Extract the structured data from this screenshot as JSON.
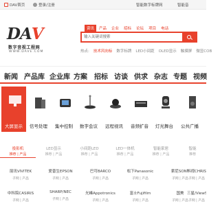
{
  "topbar": {
    "home": "DAV首页",
    "login": "登录/注册",
    "link1": "智能数字标牌网",
    "link2": "智能音"
  },
  "logo": {
    "letters_a": "DA",
    "letters_b": "V",
    "name": "数字音视工程网",
    "url": "WWW.DAVE.COM"
  },
  "search": {
    "tabs": [
      "资讯",
      "产品",
      "企业",
      "招标",
      "论坛",
      "项目",
      "电话"
    ],
    "active_tab": "资讯",
    "placeholder": "输入关键词搜索"
  },
  "hotline": [
    "热点:",
    "技术风向标",
    "数字标牌",
    "LED小间距",
    "OLED显示",
    "触摸屏",
    "微显COB"
  ],
  "mainnav": [
    "新闻",
    "产品库",
    "企业库",
    "方案",
    "招标",
    "访谈",
    "供求",
    "杂志",
    "专题",
    "视频"
  ],
  "categories": [
    "大屏显示",
    "信号处理",
    "集中控制",
    "数字会议",
    "远程视讯",
    "音频扩音",
    "灯光舞台",
    "公共广播"
  ],
  "tabs2": [
    {
      "label": "投影机",
      "sub": "推荐 | 产品"
    },
    {
      "label": "LED显示",
      "sub": "推荐 | 产品"
    },
    {
      "label": "小间距LED",
      "sub": "推荐 | 产品"
    },
    {
      "label": "LED一体机",
      "sub": "推荐 | 产品"
    },
    {
      "label": "智能家居",
      "sub": "推荐 | 产品"
    },
    {
      "label": "智能",
      "sub": "推荐"
    }
  ],
  "brand_labels": "子网 | 产品",
  "brands": [
    "丽讯VIVITEK",
    "爱普生EPSON",
    "巴可BARCO",
    "松下Panasonic",
    "索尼SONY",
    "中科院CASIRIS",
    "SHARP/NEC",
    "光峰Appotronics",
    "富士Fujifilm",
    "国美"
  ],
  "brands_extra": [
    "科视CHRISTIE",
    "三星/ViewSonic"
  ],
  "colors": {
    "accent": "#e8412c"
  }
}
